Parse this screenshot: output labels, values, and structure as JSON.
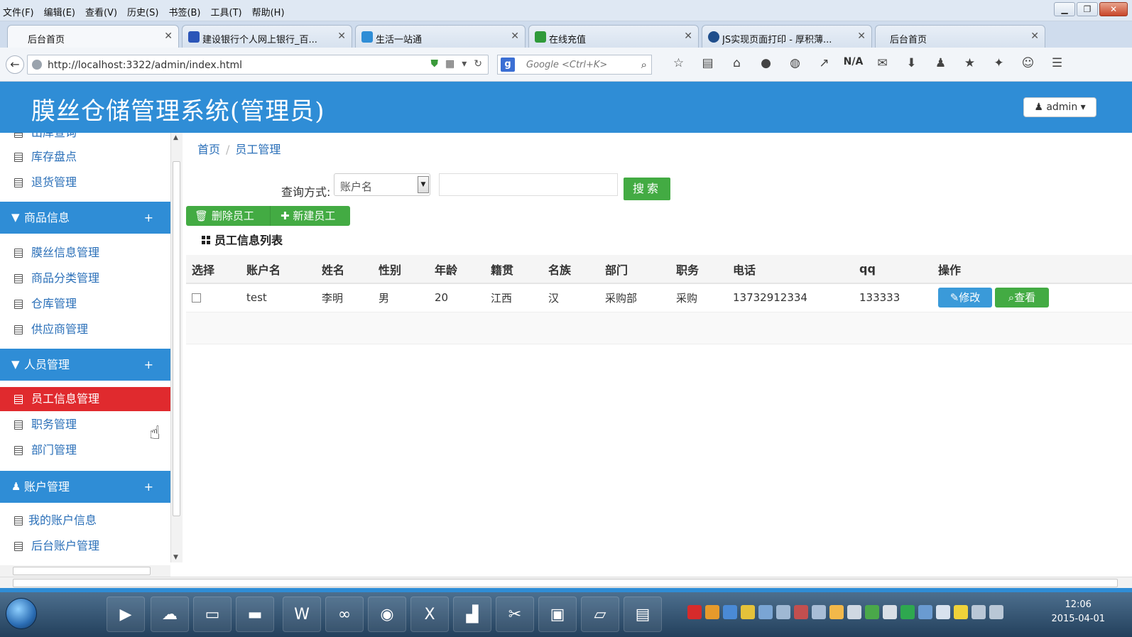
{
  "browser": {
    "menu": [
      "文件(F)",
      "编辑(E)",
      "查看(V)",
      "历史(S)",
      "书签(B)",
      "工具(T)",
      "帮助(H)"
    ],
    "tabs": [
      {
        "title": "后台首页",
        "active": true
      },
      {
        "title": "建设银行个人网上银行_百..."
      },
      {
        "title": "生活一站通"
      },
      {
        "title": "在线充值"
      },
      {
        "title": "JS实现页面打印 - 厚积薄..."
      },
      {
        "title": "后台首页"
      }
    ],
    "new_tab": "+",
    "url": "http://localhost:3322/admin/index.html",
    "search_placeholder": "Google <Ctrl+K>",
    "toolbar_na": "N/A"
  },
  "app": {
    "title": "膜丝仓储管理系统(管理员)",
    "user_button": "admin",
    "accent": "#2f8dd6"
  },
  "sidebar": {
    "items_top": [
      "出库查询",
      "库存盘点",
      "退货管理"
    ],
    "groups": [
      {
        "label": "商品信息",
        "items": [
          "膜丝信息管理",
          "商品分类管理",
          "仓库管理",
          "供应商管理"
        ]
      },
      {
        "label": "人员管理",
        "items": [
          "员工信息管理",
          "职务管理",
          "部门管理"
        ]
      },
      {
        "label": "账户管理",
        "items": [
          "我的账户信息",
          "后台账户管理"
        ]
      }
    ],
    "plus": "+",
    "active_item": "员工信息管理"
  },
  "main": {
    "breadcrumb": [
      "首页",
      "员工管理"
    ],
    "query_label": "查询方式:",
    "query_select": "账户名",
    "search_button": "搜索",
    "delete_button": "删除员工",
    "new_button": "新建员工",
    "list_title": "员工信息列表",
    "table": {
      "headers": [
        "选择",
        "账户名",
        "姓名",
        "性别",
        "年龄",
        "籍贯",
        "名族",
        "部门",
        "职务",
        "电话",
        "qq",
        "操作"
      ],
      "rows": [
        [
          "test",
          "李明",
          "男",
          "20",
          "江西",
          "汉",
          "采购部",
          "采购",
          "13732912334",
          "133333"
        ]
      ],
      "edit_label": "修改",
      "view_label": "查看"
    }
  },
  "taskbar": {
    "time": "12:06",
    "date": "2015-04-01"
  }
}
